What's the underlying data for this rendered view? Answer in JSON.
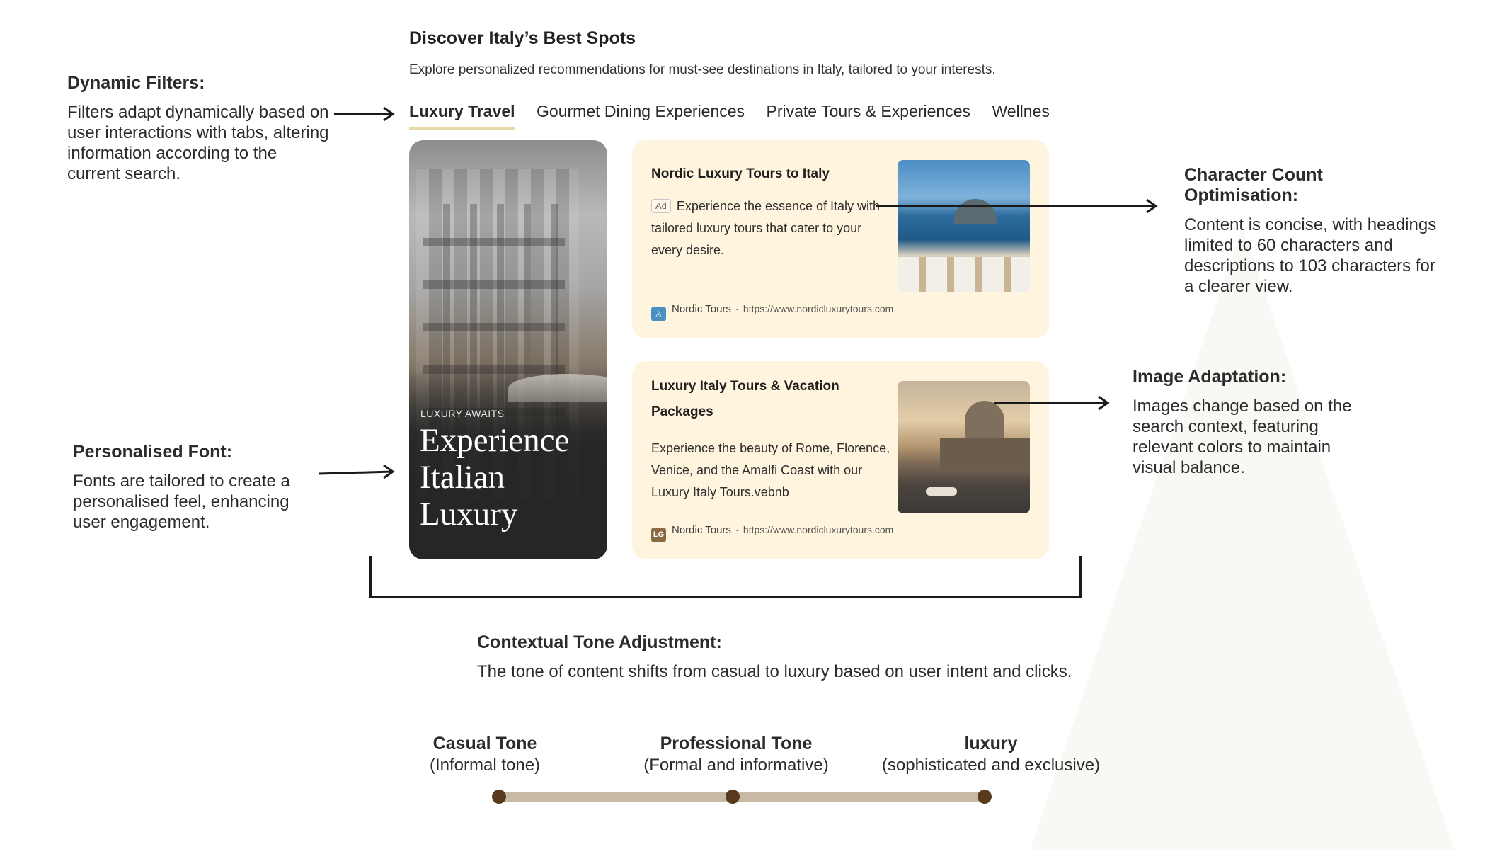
{
  "header": {
    "title": "Discover Italy’s Best Spots",
    "subtitle": "Explore personalized recommendations for must-see destinations in Italy, tailored to your interests."
  },
  "tabs": [
    {
      "label": "Luxury Travel",
      "active": true
    },
    {
      "label": "Gourmet Dining Experiences",
      "active": false
    },
    {
      "label": "Private Tours & Experiences",
      "active": false
    },
    {
      "label": "Wellness F",
      "active": false
    }
  ],
  "hero": {
    "eyebrow": "LUXURY AWAITS",
    "title": "Experience Italian Luxury"
  },
  "cards": [
    {
      "title": "Nordic Luxury Tours to Italy",
      "ad_badge": "Ad",
      "description": "Experience the essence of Italy with tailored luxury tours that cater to your every desire.",
      "source_name": "Nordic Tours",
      "source_url": "https://www.nordicluxurytours.com",
      "source_icon": "compass-logo-icon",
      "icon_color": "#4a90c2"
    },
    {
      "title": "Luxury Italy Tours & Vacation Packages",
      "description": "Experience the beauty of Rome, Florence, Venice, and the Amalfi Coast with our Luxury Italy Tours.vebnb",
      "source_name": "Nordic Tours",
      "source_url": "https://www.nordicluxurytours.com",
      "source_icon_text": "LG",
      "icon_color": "#8a6a3e"
    }
  ],
  "annotations": {
    "dynamic_filters": {
      "title": "Dynamic Filters:",
      "text": "Filters adapt dynamically based on user interactions with tabs, altering information according to the current search."
    },
    "character_count": {
      "title": "Character Count Optimisation:",
      "text": "Content is concise, with headings limited to 60 characters and descriptions to 103 characters for a clearer view."
    },
    "image_adaptation": {
      "title": "Image Adaptation:",
      "text": "Images change based on the search context, featuring relevant colors to maintain visual balance."
    },
    "personalised_font": {
      "title": "Personalised Font:",
      "text": "Fonts are tailored to create a personalised feel, enhancing user engagement."
    },
    "contextual_tone": {
      "title": "Contextual Tone Adjustment:",
      "text": "The tone of content shifts from casual to luxury based on user intent and clicks."
    }
  },
  "tone_scale": [
    {
      "name": "Casual Tone",
      "desc": "(Informal tone)"
    },
    {
      "name": "Professional Tone",
      "desc": "(Formal and informative)"
    },
    {
      "name": "luxury",
      "desc": "(sophisticated and exclusive)"
    }
  ],
  "colors": {
    "card_bg": "#fff4dd",
    "tab_underline": "#e6d9a8",
    "tone_track": "#c7b9a4",
    "tone_dot": "#5a3a1e",
    "hero_bg": "#262626"
  }
}
